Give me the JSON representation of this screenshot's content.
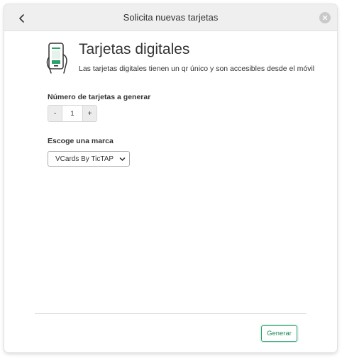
{
  "header": {
    "title": "Solicita nuevas tarjetas",
    "back_icon": "chevron-left-icon",
    "close_icon": "close-icon"
  },
  "hero": {
    "icon": "phone-card-icon",
    "title": "Tarjetas digitales",
    "description": "Las tarjetas digitales tienen un qr único y son accesibles desde el móvil"
  },
  "quantity": {
    "label": "Número de tarjetas a generar",
    "minus_label": "-",
    "value": "1",
    "plus_label": "+"
  },
  "brand": {
    "label": "Escoge una marca",
    "selected": "VCards By TicTAP"
  },
  "footer": {
    "generate_label": "Generar"
  },
  "colors": {
    "accent": "#1f8a5b",
    "header_bg": "#efefef"
  }
}
